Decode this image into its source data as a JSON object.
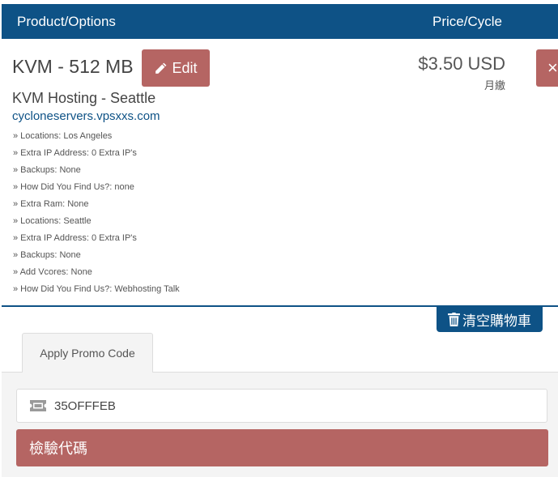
{
  "header": {
    "product_label": "Product/Options",
    "price_label": "Price/Cycle"
  },
  "item": {
    "title": "KVM - 512 MB",
    "edit_label": "Edit",
    "group": "KVM Hosting - Seattle",
    "domain": "cycloneservers.vpsxxs.com",
    "options": [
      "» Locations: Los Angeles",
      "» Extra IP Address: 0 Extra IP's",
      "» Backups: None",
      "» How Did You Find Us?: none",
      "» Extra Ram: None",
      "» Locations: Seattle",
      "» Extra IP Address: 0 Extra IP's",
      "» Backups: None",
      "» Add Vcores: None",
      "» How Did You Find Us?: Webhosting Talk"
    ],
    "price": "$3.50 USD",
    "cycle": "月繳",
    "remove_icon": "×"
  },
  "cart": {
    "empty_label": "清空購物車"
  },
  "promo": {
    "tab_label": "Apply Promo Code",
    "code_value": "35OFFFEB",
    "validate_label": "檢驗代碼"
  },
  "colors": {
    "primary": "#0e5286",
    "danger": "#b56563"
  }
}
